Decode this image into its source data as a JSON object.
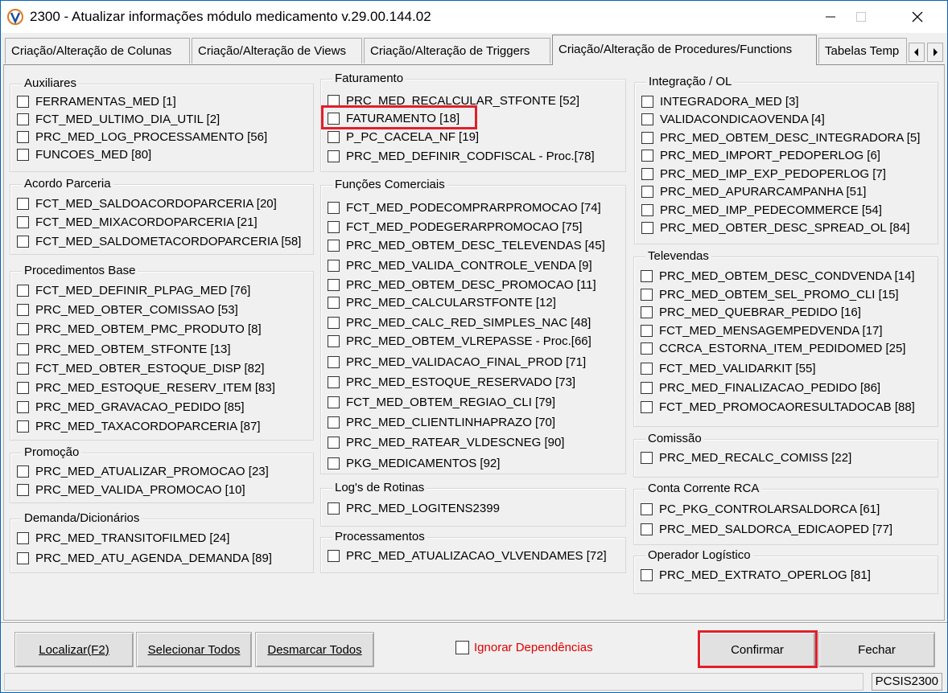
{
  "window": {
    "title": "2300 - Atualizar informações módulo medicamento v.29.00.144.02"
  },
  "tabs": [
    {
      "label": "Criação/Alteração de Colunas"
    },
    {
      "label": "Criação/Alteração de Views"
    },
    {
      "label": "Criação/Alteração de Triggers"
    },
    {
      "label": "Criação/Alteração de Procedures/Functions"
    },
    {
      "label": "Tabelas Temp"
    }
  ],
  "groups": {
    "auxiliares": {
      "title": "Auxiliares",
      "items": [
        "FERRAMENTAS_MED [1]",
        "FCT_MED_ULTIMO_DIA_UTIL [2]",
        "PRC_MED_LOG_PROCESSAMENTO [56]",
        "FUNCOES_MED [80]"
      ]
    },
    "acordo": {
      "title": "Acordo Parceria",
      "items": [
        "FCT_MED_SALDOACORDOPARCERIA [20]",
        "FCT_MED_MIXACORDOPARCERIA [21]",
        "FCT_MED_SALDOMETACORDOPARCERIA [58]"
      ]
    },
    "procedimentos": {
      "title": "Procedimentos Base",
      "items": [
        "FCT_MED_DEFINIR_PLPAG_MED [76]",
        "PRC_MED_OBTER_COMISSAO [53]",
        "PRC_MED_OBTEM_PMC_PRODUTO [8]",
        "PRC_MED_OBTEM_STFONTE [13]",
        "FCT_MED_OBTER_ESTOQUE_DISP [82]",
        "PRC_MED_ESTOQUE_RESERV_ITEM [83]",
        "PRC_MED_GRAVACAO_PEDIDO [85]",
        "PRC_MED_TAXACORDOPARCERIA [87]"
      ]
    },
    "promocao": {
      "title": "Promoção",
      "items": [
        "PRC_MED_ATUALIZAR_PROMOCAO [23]",
        "PRC_MED_VALIDA_PROMOCAO [10]"
      ]
    },
    "demanda": {
      "title": "Demanda/Dicionários",
      "items": [
        "PRC_MED_TRANSITOFILMED [24]",
        "PRC_MED_ATU_AGENDA_DEMANDA [89]"
      ]
    },
    "faturamento": {
      "title": "Faturamento",
      "items": [
        "PRC_MED_RECALCULAR_STFONTE [52]",
        "FATURAMENTO [18]",
        "P_PC_CACELA_NF [19]",
        "PRC_MED_DEFINIR_CODFISCAL - Proc.[78]"
      ]
    },
    "funcoes": {
      "title": "Funções Comerciais",
      "items": [
        "FCT_MED_PODECOMPRARPROMOCAO [74]",
        "FCT_MED_PODEGERARPROMOCAO [75]",
        "PRC_MED_OBTEM_DESC_TELEVENDAS [45]",
        "PRC_MED_VALIDA_CONTROLE_VENDA [9]",
        "PRC_MED_OBTEM_DESC_PROMOCAO [11]",
        "PRC_MED_CALCULARSTFONTE [12]",
        "PRC_MED_CALC_RED_SIMPLES_NAC [48]",
        "PRC_MED_OBTEM_VLREPASSE - Proc.[66]",
        "PRC_MED_VALIDACAO_FINAL_PROD [71]",
        "PRC_MED_ESTOQUE_RESERVADO [73]",
        "FCT_MED_OBTEM_REGIAO_CLI [79]",
        "PRC_MED_CLIENTLINHAPRAZO [70]",
        "PRC_MED_RATEAR_VLDESCNEG [90]",
        "PKG_MEDICAMENTOS [92]"
      ]
    },
    "logs": {
      "title": "Log's de Rotinas",
      "items": [
        "PRC_MED_LOGITENS2399"
      ]
    },
    "processamentos": {
      "title": "Processamentos",
      "items": [
        "PRC_MED_ATUALIZACAO_VLVENDAMES [72]"
      ]
    },
    "integracao": {
      "title": "Integração / OL",
      "items": [
        "INTEGRADORA_MED [3]",
        "VALIDACONDICAOVENDA [4]",
        "PRC_MED_OBTEM_DESC_INTEGRADORA [5]",
        "PRC_MED_IMPORT_PEDOPERLOG [6]",
        "PRC_MED_IMP_EXP_PEDOPERLOG [7]",
        "PRC_MED_APURARCAMPANHA [51]",
        "PRC_MED_IMP_PEDECOMMERCE [54]",
        "PRC_MED_OBTER_DESC_SPREAD_OL [84]"
      ]
    },
    "televendas": {
      "title": "Televendas",
      "items": [
        "PRC_MED_OBTEM_DESC_CONDVENDA [14]",
        "PRC_MED_OBTEM_SEL_PROMO_CLI [15]",
        "PRC_MED_QUEBRAR_PEDIDO [16]",
        "FCT_MED_MENSAGEMPEDVENDA [17]",
        "CCRCA_ESTORNA_ITEM_PEDIDOMED [25]",
        "FCT_MED_VALIDARKIT [55]",
        "PRC_MED_FINALIZACAO_PEDIDO [86]",
        "FCT_MED_PROMOCAORESULTADOCAB [88]"
      ]
    },
    "comissao": {
      "title": "Comissão",
      "items": [
        "PRC_MED_RECALC_COMISS [22]"
      ]
    },
    "conta": {
      "title": "Conta Corrente RCA",
      "items": [
        "PC_PKG_CONTROLARSALDORCA [61]",
        "PRC_MED_SALDORCA_EDICAOPED [77]"
      ]
    },
    "operador": {
      "title": "Operador Logístico",
      "items": [
        "PRC_MED_EXTRATO_OPERLOG [81]"
      ]
    }
  },
  "buttons": {
    "localizar": "Localizar(F2)",
    "selecionar": "Selecionar Todos",
    "desmarcar": "Desmarcar Todos",
    "ignorar": "Ignorar Dependências",
    "confirmar": "Confirmar",
    "fechar": "Fechar"
  },
  "status": {
    "code": "PCSIS2300"
  },
  "colors": {
    "highlight": "#e0202a",
    "ignorar_text": "#e00000",
    "title_border": "#0a64b4"
  }
}
